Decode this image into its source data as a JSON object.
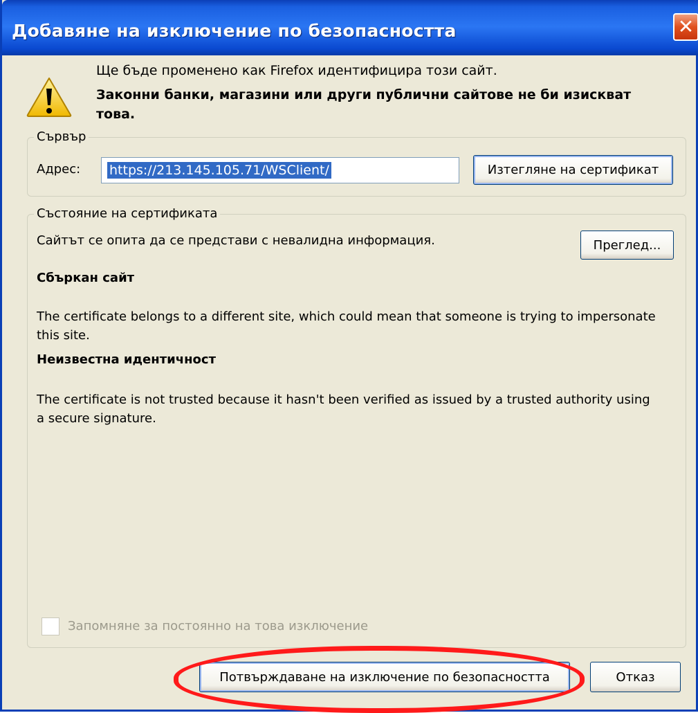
{
  "window": {
    "title": "Добавяне на изключение по безопасността",
    "close_icon": "close-icon"
  },
  "message": {
    "line1": "Ще бъде променено как Firefox идентифицира този сайт.",
    "line2": "Законни банки, магазини или други публични сайтове не би изискват това."
  },
  "server": {
    "legend": "Сървър",
    "address_label": "Адрес:",
    "address_value": "https://213.145.105.71/WSClient/",
    "get_cert_button": "Изтегляне на сертификат"
  },
  "certificate": {
    "legend": "Състояние на сертификата",
    "status_text": "Сайтът се опита да се представи с невалидна информация.",
    "view_button": "Преглед...",
    "issue1_title": "Сбъркан сайт",
    "issue1_text": "The certificate belongs to a different site, which could mean that someone is trying to impersonate this site.",
    "issue2_title": "Неизвестна идентичност",
    "issue2_text": "The certificate is not trusted because it hasn't been verified as issued by a trusted authority using a secure signature.",
    "remember_label": "Запомняне за постоянно на това изключение",
    "remember_checked": false
  },
  "footer": {
    "confirm_button": "Потвърждаване на изключение по безопасността",
    "cancel_button": "Отказ"
  },
  "colors": {
    "annotation": "#ff1a1a",
    "titlebar": "#2b76f3",
    "selection": "#316ac5"
  }
}
